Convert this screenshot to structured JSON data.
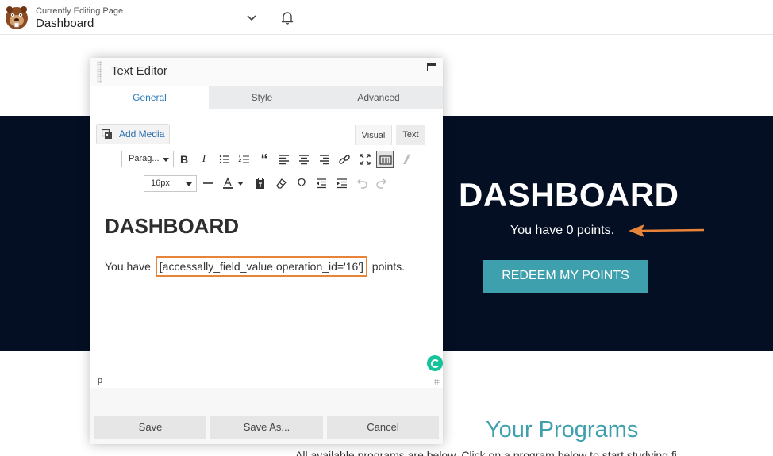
{
  "topbar": {
    "subtitle": "Currently Editing Page",
    "page_name": "Dashboard",
    "icons": {
      "logo": "beaver-logo",
      "dropdown": "chevron-down-icon",
      "notifications": "bell-icon"
    }
  },
  "page": {
    "hero_title": "DASHBOARD",
    "points_text": "You have 0 points.",
    "redeem_label": "REDEEM MY POINTS",
    "programs_heading": "Your Programs",
    "programs_text": "All available programs are below. Click on a program below to start studying fi",
    "colors": {
      "hero_bg": "#050f24",
      "accent": "#3fa0ad",
      "annotation": "#e8833a"
    }
  },
  "panel": {
    "title": "Text Editor",
    "tabs": [
      {
        "label": "General",
        "active": true
      },
      {
        "label": "Style",
        "active": false
      },
      {
        "label": "Advanced",
        "active": false
      }
    ],
    "add_media_label": "Add Media",
    "mode_visual": "Visual",
    "mode_text": "Text",
    "format_select": "Parag...",
    "size_select": "16px",
    "content_heading": "DASHBOARD",
    "content_before": "You have",
    "content_shortcode": "[accessally_field_value operation_id='16']",
    "content_after": "points.",
    "status_path": "p",
    "buttons": {
      "save": "Save",
      "save_as": "Save As...",
      "cancel": "Cancel"
    }
  }
}
